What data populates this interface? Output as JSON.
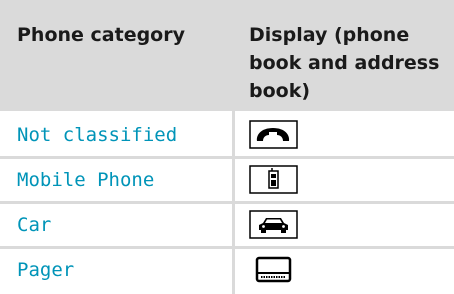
{
  "table": {
    "headers": {
      "category": "Phone category",
      "display": "Display (phone book and address book)"
    },
    "rows": [
      {
        "category": "Not classified",
        "icon": "handset-icon"
      },
      {
        "category": "Mobile Phone",
        "icon": "mobile-phone-icon"
      },
      {
        "category": "Car",
        "icon": "car-icon"
      },
      {
        "category": "Pager",
        "icon": "pager-icon"
      }
    ],
    "colors": {
      "header_bg": "#dadada",
      "text_link": "#0094b8",
      "grid": "#dadada"
    }
  }
}
